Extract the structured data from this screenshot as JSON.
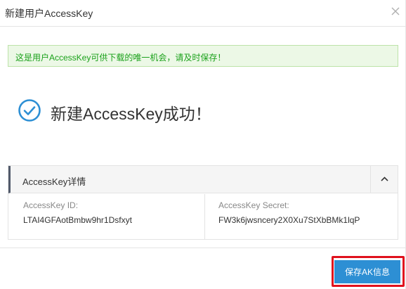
{
  "dialog": {
    "title": "新建用户AccessKey",
    "close_icon": "close-icon"
  },
  "alert": {
    "text": "这是用户AccessKey可供下载的唯一机会，请及时保存！",
    "color": "#1aa11a"
  },
  "success": {
    "icon": "check-circle-icon",
    "message": "新建AccessKey成功！",
    "icon_color": "#2d8fd4"
  },
  "details": {
    "title": "AccessKey详情",
    "toggle_icon": "chevron-up-icon",
    "access_key_id_label": "AccessKey ID:",
    "access_key_id_value": "LTAI4GFAotBmbw9hr1Dsfxyt",
    "access_key_secret_label": "AccessKey Secret:",
    "access_key_secret_value": "FW3k6jwsncery2X0Xu7StXbBMk1lqP"
  },
  "footer": {
    "save_label": "保存AK信息",
    "button_color": "#2d8fd4",
    "highlight_color": "#e0111d"
  }
}
